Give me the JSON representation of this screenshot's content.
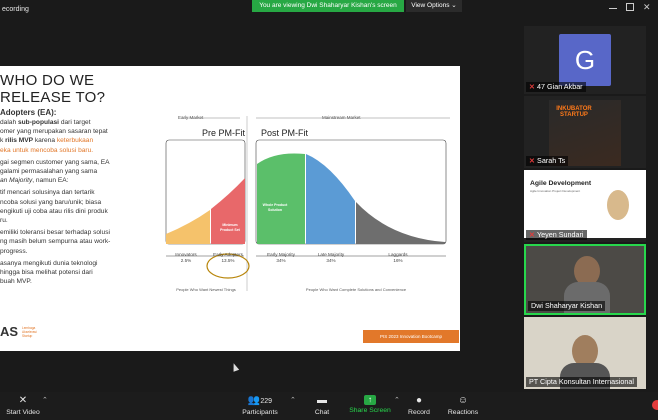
{
  "topbar": {
    "recording_label": "ecording",
    "viewing_banner": "You are viewing Dwi Shaharyar Kishan's screen",
    "view_options": "View Options",
    "view_options_caret": "⌄"
  },
  "slide": {
    "title_line1": "WHO DO WE",
    "title_line2": "RELEASE TO?",
    "ea_heading": "Adopters (EA):",
    "p1_a": "dalah ",
    "p1_bold": "sub-populasi",
    "p1_b": " dari target",
    "p1_c": "omer yang merupakan sasaran tepat",
    "p1_d": "k ",
    "p1_bold2": "rilis MVP",
    "p1_e": " karena ",
    "p1_orange1": "keterbukaan",
    "p1_orange2": "eka untuk mencoba solusi baru.",
    "p2_a": "gai segmen customer yang sama, EA",
    "p2_b": "galami permasalahan yang sama",
    "p2_c_ital": "an Majority",
    "p2_d": ", namun EA:",
    "p3_a": "tif mencari solusinya dan tertarik",
    "p3_b": "ncoba solusi yang baru/unik; biasa",
    "p3_c": "engikuti uji coba atau rilis dini produk",
    "p3_d": "ru.",
    "p4_a": "emiliki toleransi besar terhadap solusi",
    "p4_b": "ng masih belum sempurna atau work-",
    "p4_c": "progress.",
    "p5_a": "asanya mengikuti dunia teknologi",
    "p5_b": "hingga bisa melihat potensi dari",
    "p5_c": "buah MVP.",
    "logo": "AS",
    "logo_sub": "Lembaga Akselerasi Startup",
    "early_market": "Early Market",
    "mainstream_market": "Mainstream Market",
    "pre_pm_fit": "Pre PM-Fit",
    "post_pm_fit": "Post PM-Fit",
    "callout_minimum": "Minimum Product Set",
    "callout_whole": "Whole Product Solution",
    "innovators": "Innovators",
    "innovators_pct": "2.5%",
    "early_adopters": "Early Adopters",
    "early_adopters_pct": "13.5%",
    "early_majority": "Early Majority",
    "early_majority_pct": "34%",
    "late_majority": "Late Majority",
    "late_majority_pct": "34%",
    "laggards": "Laggards",
    "laggards_pct": "16%",
    "note_left": "People Who Want Newest Things",
    "note_right": "People Who Want Complete Solutions and Convenience",
    "bootcamp": "PIS 2023 Innovation Bootcamp"
  },
  "participants": [
    {
      "name": "47 Gian Akbar",
      "initial": "G"
    },
    {
      "name": "Sarah Ts",
      "poster_title": "INKUBATOR STARTUP"
    },
    {
      "name": "Yeyen Sundari",
      "slide_title": "Agile Development",
      "slide_sub": "Agile Innovation Project Development"
    },
    {
      "name": "Dwi Shaharyar Kishan"
    },
    {
      "name": "PT Cipta Konsultan Internasional"
    }
  ],
  "toolbar": {
    "start_video": "Start Video",
    "participants": "Participants",
    "participants_count": "229",
    "chat": "Chat",
    "share_screen": "Share Screen",
    "record": "Record",
    "reactions": "Reactions"
  },
  "colors": {
    "green": "#27a844",
    "orange": "#e2782a",
    "curve_green": "#5bbf6a",
    "curve_blue": "#5b9bd5",
    "curve_gray": "#6e6e6e",
    "curve_yellow": "#f5c26b",
    "curve_red": "#e8686a"
  }
}
